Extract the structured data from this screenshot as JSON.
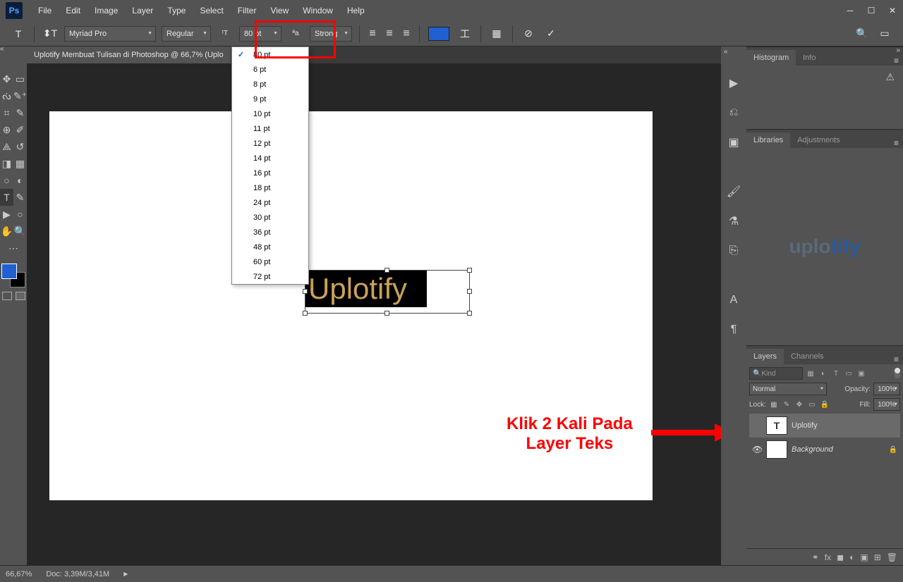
{
  "menubar": [
    "File",
    "Edit",
    "Image",
    "Layer",
    "Type",
    "Select",
    "Filter",
    "View",
    "Window",
    "Help"
  ],
  "options": {
    "font": "Myriad Pro",
    "style": "Regular",
    "size": "80 pt",
    "aa": "Strong"
  },
  "tab_title": "Uplotify Membuat Tulisan di Photoshop @ 66,7% (Uplo",
  "size_menu": {
    "selected": "80 pt",
    "items": [
      "80 pt",
      "6 pt",
      "8 pt",
      "9 pt",
      "10 pt",
      "11 pt",
      "12 pt",
      "14 pt",
      "16 pt",
      "18 pt",
      "24 pt",
      "30 pt",
      "36 pt",
      "48 pt",
      "60 pt",
      "72 pt"
    ]
  },
  "canvas_text": "Uplotify",
  "panels": {
    "histogram": {
      "tabs": [
        "Histogram",
        "Info"
      ]
    },
    "libraries": {
      "tabs": [
        "Libraries",
        "Adjustments"
      ],
      "watermark": "uplotify"
    },
    "layers": {
      "tabs": [
        "Layers",
        "Channels"
      ],
      "filter_placeholder": "Kind",
      "blend": "Normal",
      "opacity_label": "Opacity:",
      "opacity": "100%",
      "lock_label": "Lock:",
      "fill_label": "Fill:",
      "fill": "100%",
      "items": [
        {
          "name": "Uplotify",
          "type": "text",
          "visible": false,
          "selected": true,
          "locked": false
        },
        {
          "name": "Background",
          "type": "raster",
          "visible": true,
          "selected": false,
          "locked": true
        }
      ]
    }
  },
  "status": {
    "zoom": "66,67%",
    "doc": "Doc: 3,39M/3,41M"
  },
  "annotation": {
    "line1": "Klik 2 Kali Pada",
    "line2": "Layer Teks"
  }
}
